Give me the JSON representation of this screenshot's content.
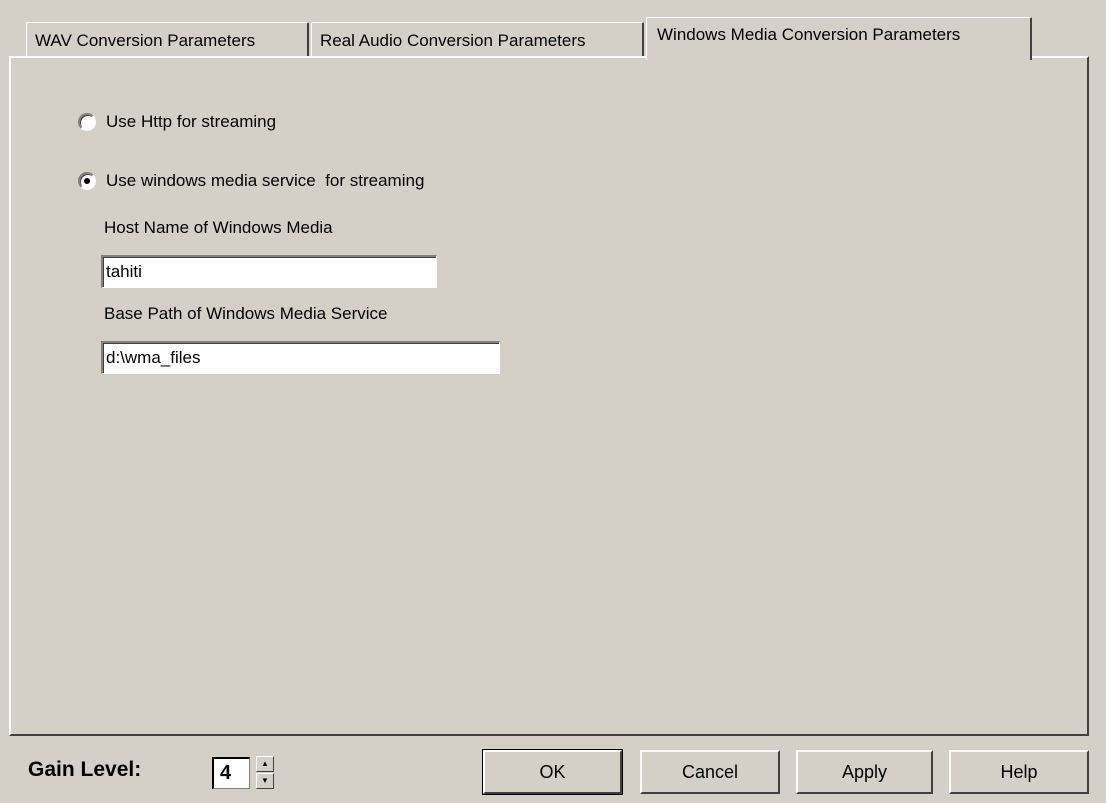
{
  "tabs": [
    {
      "label": "WAV Conversion Parameters",
      "active": false
    },
    {
      "label": "Real Audio Conversion Parameters",
      "active": false
    },
    {
      "label": "Windows Media Conversion Parameters",
      "active": true
    }
  ],
  "streaming": {
    "options": [
      {
        "label": "Use Http for streaming",
        "selected": false
      },
      {
        "label": "Use windows media service  for streaming",
        "selected": true
      }
    ],
    "host_label": "Host Name of Windows Media",
    "host_value": "tahiti",
    "base_path_label": "Base Path of Windows Media Service",
    "base_path_value": "d:\\wma_files"
  },
  "footer": {
    "gain_label": "Gain Level:",
    "gain_value": "4",
    "spin_up_glyph": "▲",
    "spin_down_glyph": "▼",
    "ok_label": "OK",
    "cancel_label": "Cancel",
    "apply_label": "Apply",
    "help_label": "Help"
  }
}
